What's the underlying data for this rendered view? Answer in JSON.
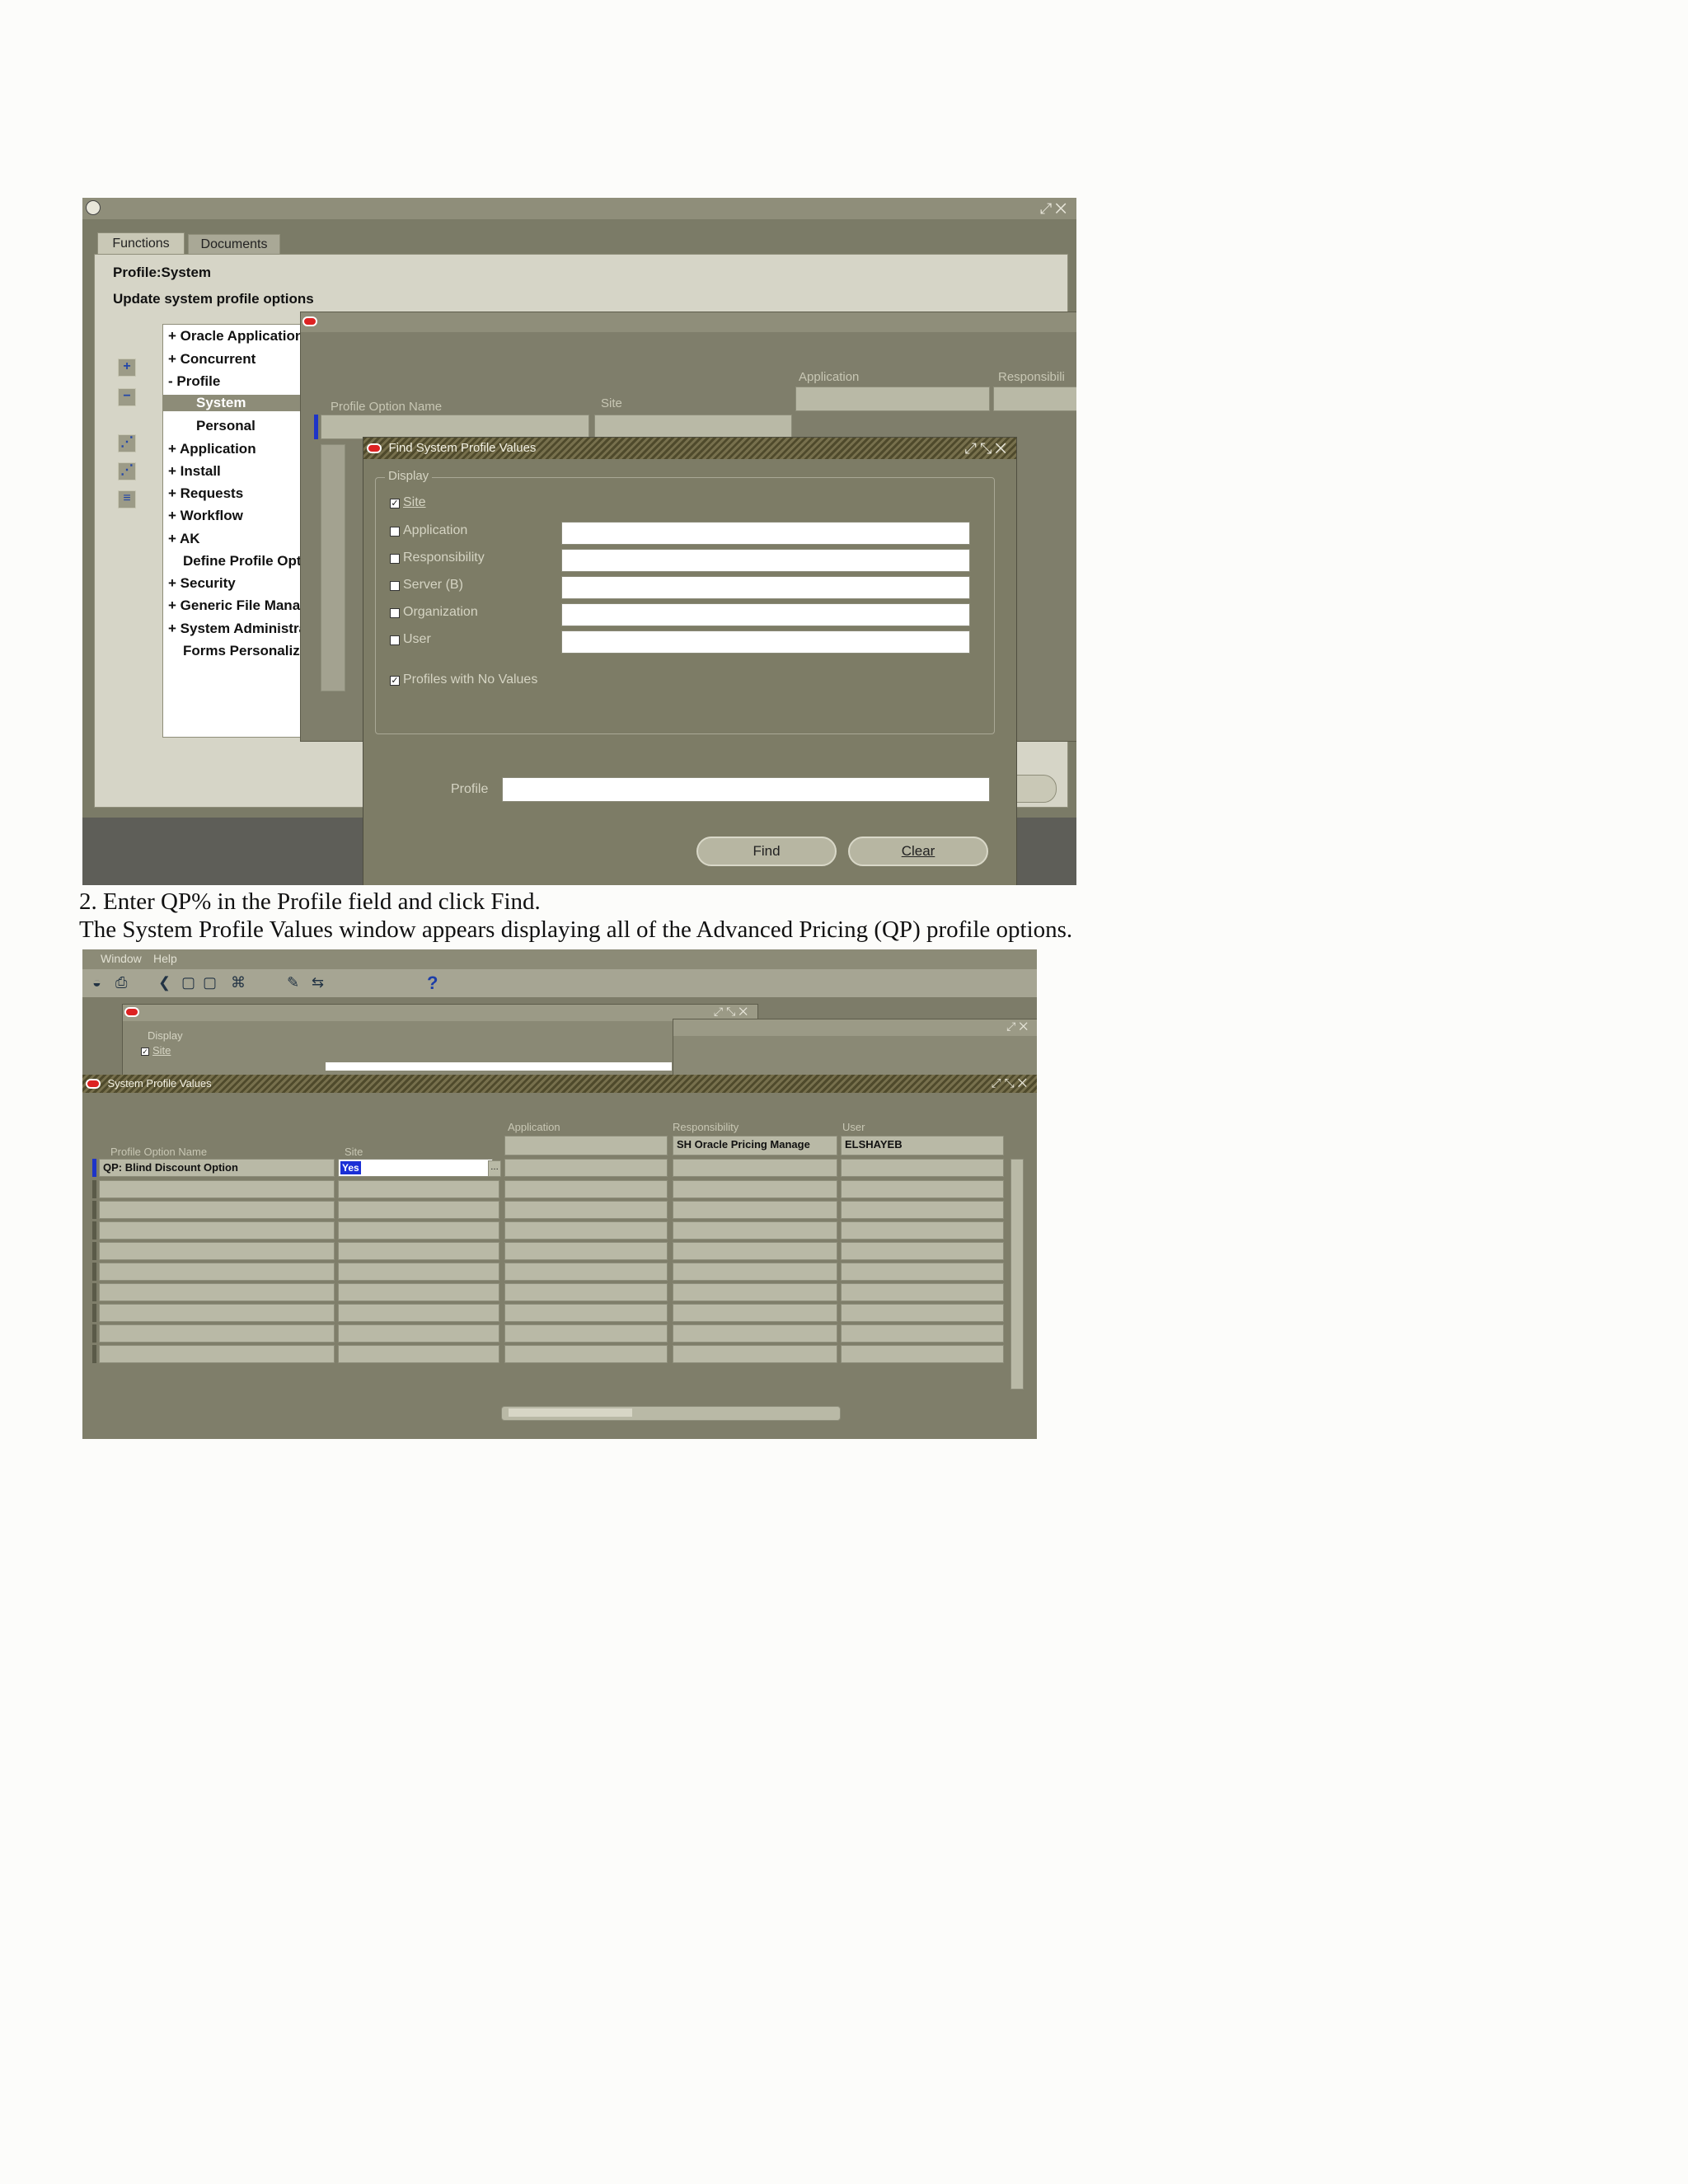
{
  "screenshot1": {
    "tabs": [
      "Functions",
      "Documents"
    ],
    "heading": "Profile:System",
    "subheading": "Update system profile options",
    "tree": [
      {
        "label": "+ Oracle Applications",
        "selected": false
      },
      {
        "label": "+ Concurrent",
        "selected": false
      },
      {
        "label": "- Profile",
        "selected": false
      },
      {
        "label": "System",
        "selected": true
      },
      {
        "label": "Personal",
        "selected": false
      },
      {
        "label": "+ Application",
        "selected": false
      },
      {
        "label": "+ Install",
        "selected": false
      },
      {
        "label": "+ Requests",
        "selected": false
      },
      {
        "label": "+ Workflow",
        "selected": false
      },
      {
        "label": "+ AK",
        "selected": false
      },
      {
        "label": "Define Profile Options",
        "selected": false
      },
      {
        "label": "+ Security",
        "selected": false
      },
      {
        "label": "+ Generic File Manager",
        "selected": false
      },
      {
        "label": "+ System Administrator",
        "selected": false
      },
      {
        "label": "Forms Personalization",
        "selected": false
      }
    ],
    "values_window": {
      "col_profile_option_name": "Profile Option Name",
      "col_site": "Site",
      "col_application": "Application",
      "col_responsibility": "Responsibili"
    },
    "find_dialog": {
      "title": "Find System Profile Values",
      "group_label": "Display",
      "options": [
        {
          "label": "Site",
          "checked": true,
          "has_field": false
        },
        {
          "label": "Application",
          "checked": false,
          "has_field": true
        },
        {
          "label": "Responsibility",
          "checked": false,
          "has_field": true
        },
        {
          "label": "Server (B)",
          "checked": false,
          "has_field": true
        },
        {
          "label": "Organization",
          "checked": false,
          "has_field": true
        },
        {
          "label": "User",
          "checked": false,
          "has_field": true
        }
      ],
      "profiles_no_values": {
        "label": "Profiles with No Values",
        "checked": true
      },
      "profile_label": "Profile",
      "profile_value": "",
      "find_button": "Find",
      "clear_button": "Clear"
    }
  },
  "caption_line1": "2. Enter QP% in the Profile field and click Find.",
  "caption_line2": "The System Profile Values window appears displaying all of the Advanced Pricing (QP) profile options.",
  "screenshot2": {
    "menu": [
      "Window",
      "Help"
    ],
    "bg_dialog": {
      "group_label": "Display",
      "site_label": "Site"
    },
    "window_title": "System Profile Values",
    "columns": {
      "profile_option_name": "Profile Option Name",
      "site": "Site",
      "application": "Application",
      "responsibility": "Responsibility",
      "user": "User"
    },
    "context": {
      "application": "",
      "responsibility": "SH Oracle Pricing Manage",
      "user": "ELSHAYEB"
    },
    "rows": [
      {
        "name": "QP: Blind Discount Option",
        "site": "Yes",
        "application": "",
        "responsibility": "",
        "user": ""
      }
    ],
    "empty_rows": 9
  }
}
